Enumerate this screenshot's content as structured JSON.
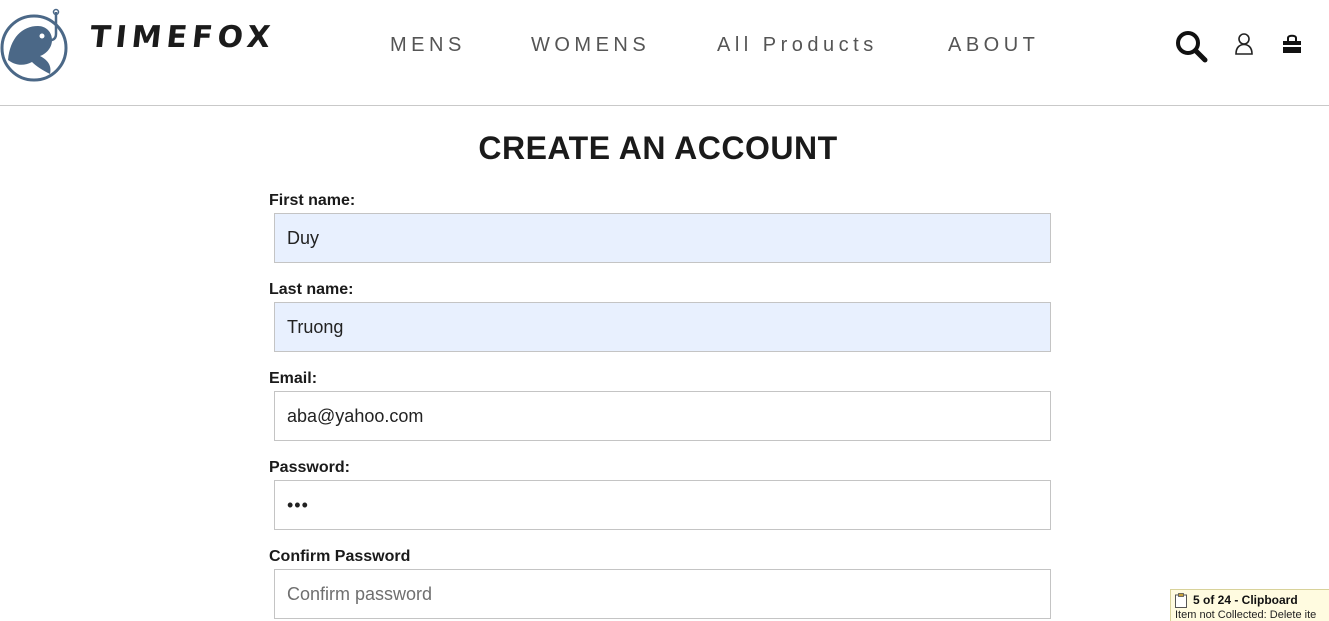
{
  "brand": {
    "name": "TIMEFOX",
    "logo_icon": "fish-hook-logo-icon",
    "logo_color": "#4b6887"
  },
  "nav": {
    "items": [
      {
        "label": "MENS"
      },
      {
        "label": "WOMENS"
      },
      {
        "label": "All Products"
      },
      {
        "label": "ABOUT"
      }
    ]
  },
  "header_icons": {
    "search": "search-icon",
    "account": "user-icon",
    "cart": "shopping-bag-icon"
  },
  "form": {
    "title": "CREATE AN ACCOUNT",
    "fields": {
      "first_name": {
        "label": "First name:",
        "value": "Duy"
      },
      "last_name": {
        "label": "Last name:",
        "value": "Truong"
      },
      "email": {
        "label": "Email:",
        "value": "aba@yahoo.com"
      },
      "password": {
        "label": "Password:",
        "value": "•••"
      },
      "confirm_password": {
        "label": "Confirm Password",
        "value": "",
        "placeholder": "Confirm password"
      }
    },
    "autofill_color": "#e8f0fe"
  },
  "clipboard_popup": {
    "title": "5 of 24 - Clipboard",
    "message": "Item not Collected: Delete ite"
  }
}
